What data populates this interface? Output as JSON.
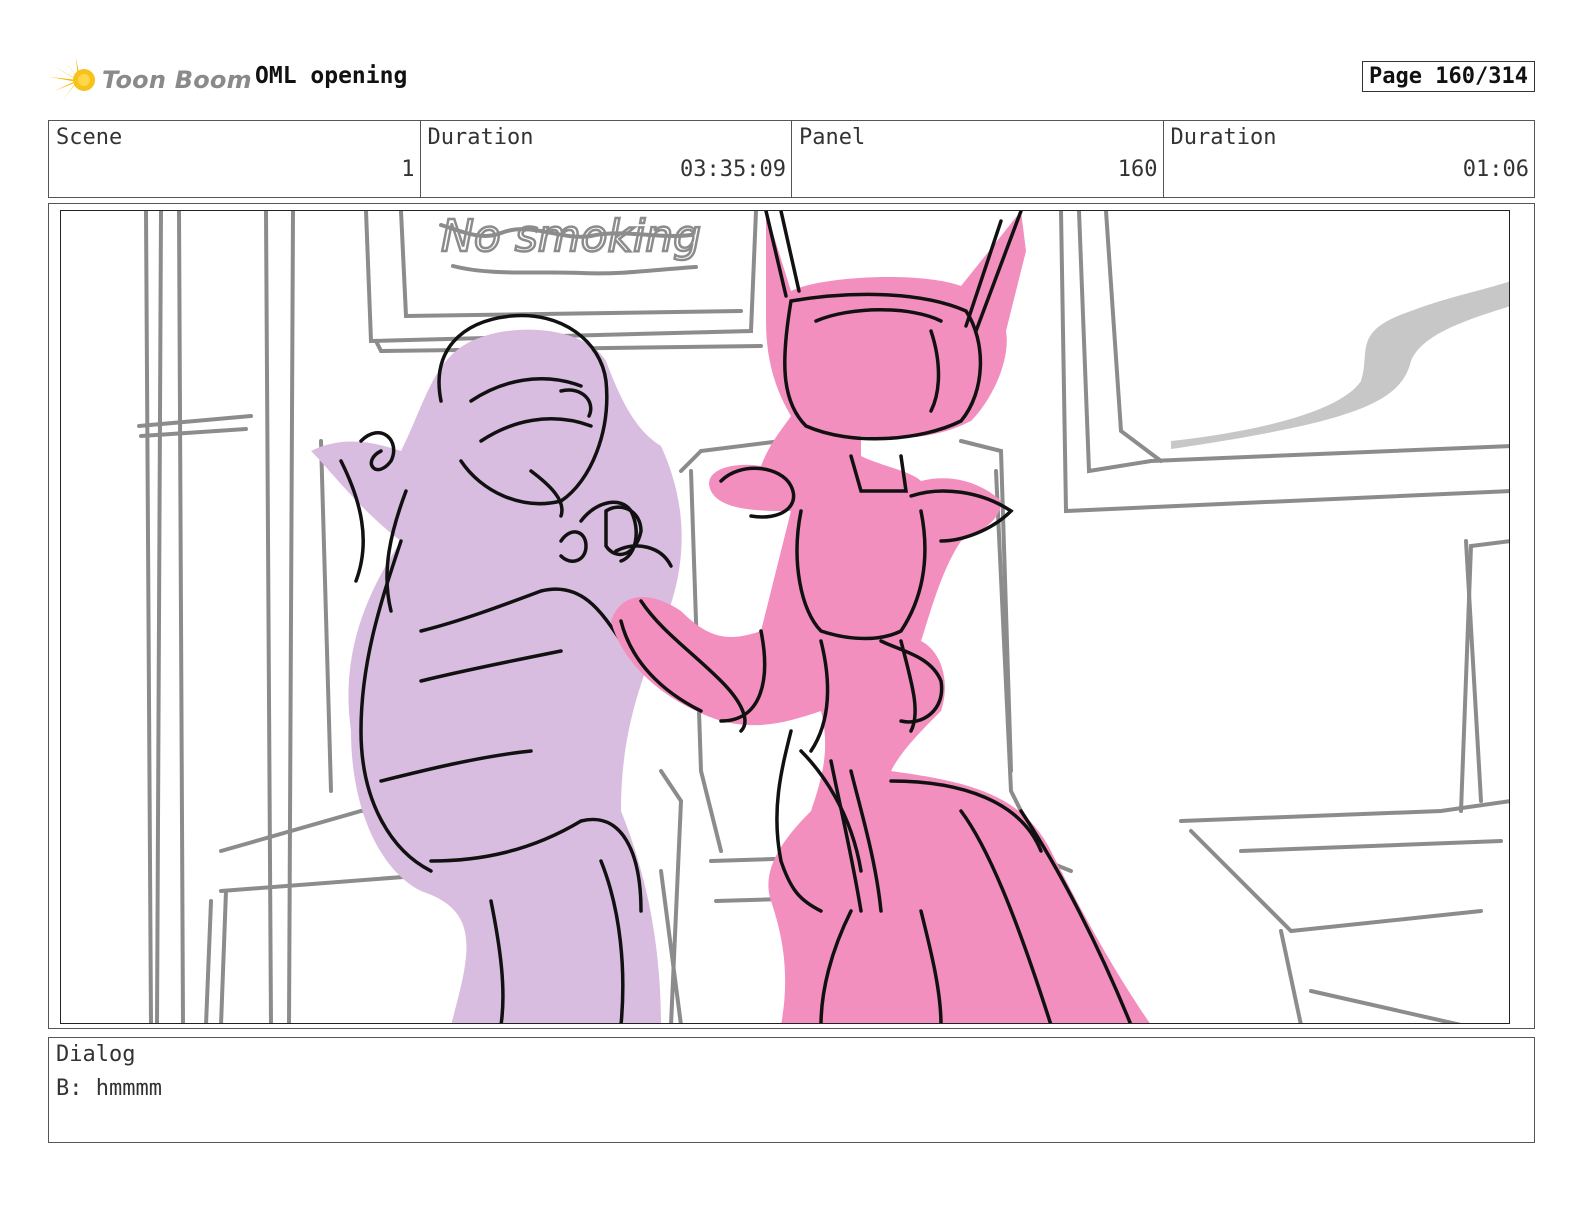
{
  "header": {
    "logo_text": "Toon Boom",
    "project_title": "OML opening",
    "page_label": "Page 160/314"
  },
  "info": {
    "scene_label": "Scene",
    "scene_value": "1",
    "scene_duration_label": "Duration",
    "scene_duration_value": "03:35:09",
    "panel_label": "Panel",
    "panel_value": "160",
    "panel_duration_label": "Duration",
    "panel_duration_value": "01:06"
  },
  "panel_sketch": {
    "sign_text": "No smoking",
    "colors": {
      "background_lines": "#8c8c8c",
      "character_left_fill": "#d9bde0",
      "character_right_fill": "#f38fbf",
      "ink": "#111111"
    }
  },
  "dialog": {
    "label": "Dialog",
    "text": "B: hmmmm"
  }
}
